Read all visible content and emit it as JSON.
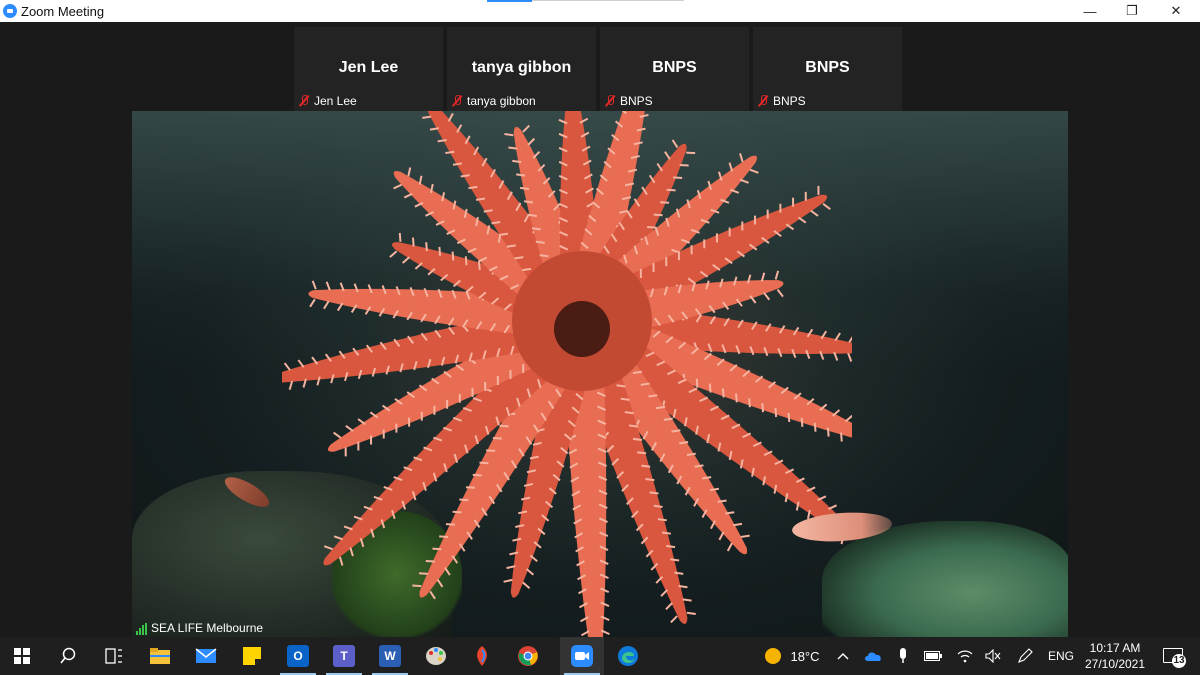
{
  "window": {
    "title": "Zoom Meeting",
    "minimize": "—",
    "restore": "❐",
    "close": "✕"
  },
  "participants": [
    {
      "display": "Jen Lee",
      "label": "Jen Lee"
    },
    {
      "display": "tanya gibbon",
      "label": "tanya gibbon"
    },
    {
      "display": "BNPS",
      "label": "BNPS"
    },
    {
      "display": "BNPS",
      "label": "BNPS"
    }
  ],
  "active_speaker": {
    "label": "SEA LIFE Melbourne"
  },
  "taskbar": {
    "apps": [
      "windows-start",
      "search",
      "task-view",
      "file-explorer",
      "mail",
      "sticky-notes",
      "outlook",
      "teams",
      "word",
      "paint",
      "paint-3d",
      "chrome",
      "zoom",
      "edge"
    ],
    "weather": "18°C",
    "language": "ENG",
    "time": "10:17 AM",
    "date": "27/10/2021",
    "notifications": "13"
  },
  "colors": {
    "zoom_blue": "#2d8cff",
    "mute_red": "#e02828",
    "signal_green": "#3cc34a",
    "taskbar": "#1f1f1f"
  }
}
